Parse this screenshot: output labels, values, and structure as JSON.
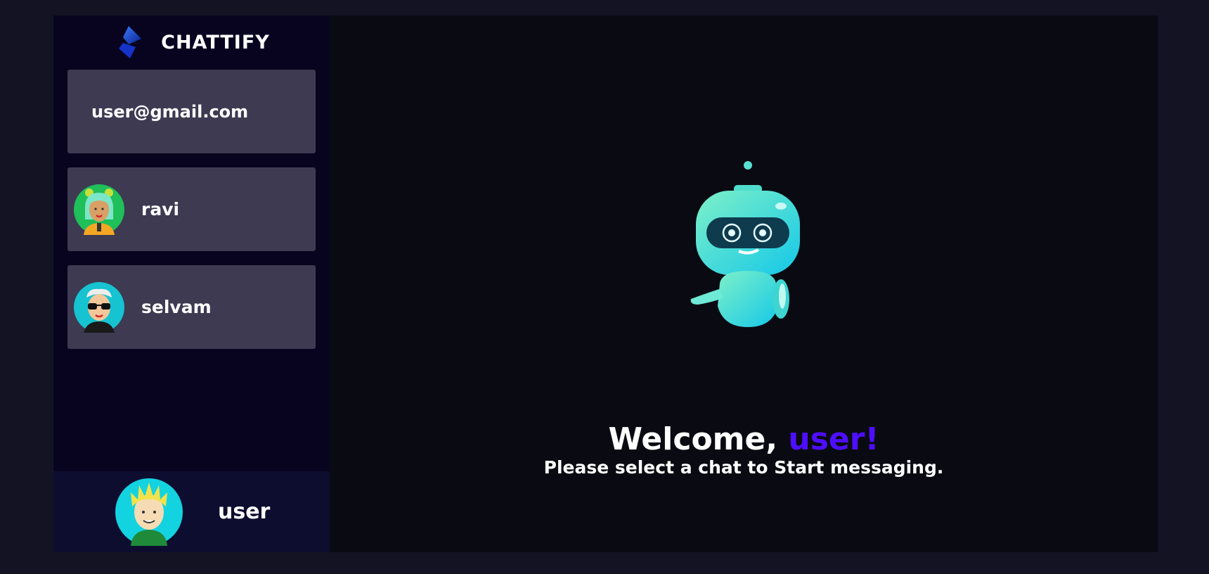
{
  "app": {
    "name": "CHATTIFY"
  },
  "sidebar": {
    "email": "user@gmail.com",
    "contacts": [
      {
        "name": "ravi",
        "avatar": "girl-avatar-icon"
      },
      {
        "name": "selvam",
        "avatar": "sunglasses-avatar-icon"
      }
    ],
    "current_user": {
      "name": "user",
      "avatar": "blonde-boy-avatar-icon"
    }
  },
  "welcome": {
    "greeting": "Welcome, ",
    "username": "user!",
    "subtitle": "Please select a chat to Start messaging."
  },
  "colors": {
    "background": "#131324",
    "sidebar": "#080420",
    "card": "#3d3a52",
    "accent": "#4e0eff",
    "main": "#0a0b12"
  }
}
